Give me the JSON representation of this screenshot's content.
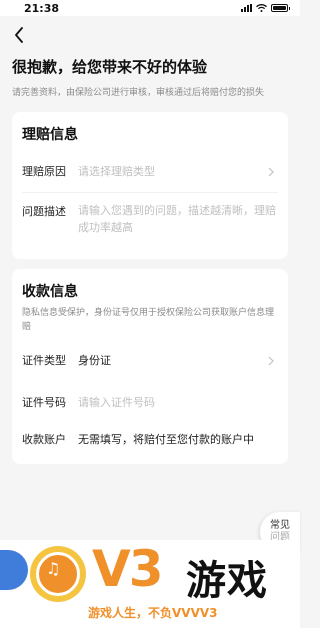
{
  "status_bar": {
    "time": "21:38"
  },
  "header": {
    "title": "很抱歉，给您带来不好的体验",
    "subtitle": "请完善资料，由保险公司进行审核，审核通过后将赔付您的损失"
  },
  "claim_card": {
    "title": "理赔信息",
    "reason": {
      "label": "理赔原因",
      "placeholder": "请选择理赔类型"
    },
    "description": {
      "label": "问题描述",
      "placeholder": "请输入您遇到的问题，描述越清晰，理赔成功率越高"
    }
  },
  "payment_card": {
    "title": "收款信息",
    "desc": "隐私信息受保护，身份证号仅用于授权保险公司获取账户信息理赔",
    "id_type": {
      "label": "证件类型",
      "value": "身份证"
    },
    "id_number": {
      "label": "证件号码",
      "placeholder": "请输入证件号码"
    },
    "account": {
      "label": "收款账户",
      "value": "无需填写，将赔付至您付款的账户中"
    }
  },
  "faq_button": {
    "line1": "常见",
    "line2": "问题"
  },
  "watermark": {
    "logo_text": "V3",
    "brand": "游戏",
    "slogan": "游戏人生，不负VVVV3"
  },
  "colors": {
    "accent": "#f0902a",
    "placeholder": "#c0c0c0",
    "background": "#f5f5f5"
  }
}
